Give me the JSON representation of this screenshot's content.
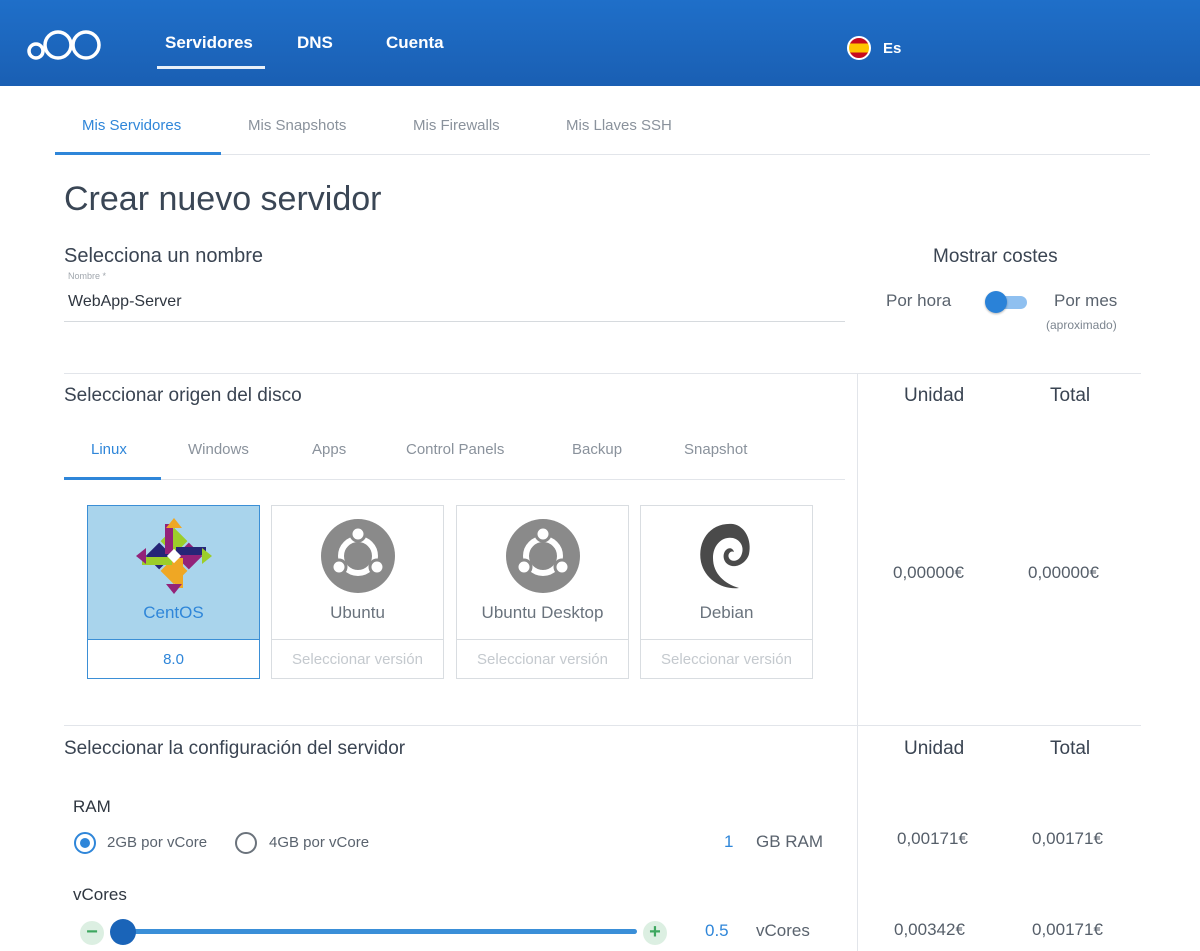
{
  "header": {
    "nav": [
      "Servidores",
      "DNS",
      "Cuenta"
    ],
    "language": "Es"
  },
  "subtabs": [
    "Mis Servidores",
    "Mis Snapshots",
    "Mis Firewalls",
    "Mis Llaves SSH"
  ],
  "page_title": "Crear nuevo servidor",
  "name_section": {
    "title": "Selecciona un nombre",
    "field_label": "Nombre *",
    "field_value": "WebApp-Server"
  },
  "costs": {
    "title": "Mostrar costes",
    "left_label": "Por hora",
    "right_label": "Por mes",
    "right_note": "(aproximado)",
    "toggle_state": "Por hora"
  },
  "disk_section": {
    "title": "Seleccionar origen del disco",
    "tabs": [
      "Linux",
      "Windows",
      "Apps",
      "Control Panels",
      "Backup",
      "Snapshot"
    ],
    "cards": [
      {
        "name": "CentOS",
        "version": "8.0",
        "icon": "centos-icon",
        "selected": true
      },
      {
        "name": "Ubuntu",
        "version": "Seleccionar versión",
        "icon": "ubuntu-icon",
        "selected": false
      },
      {
        "name": "Ubuntu Desktop",
        "version": "Seleccionar versión",
        "icon": "ubuntu-icon",
        "selected": false
      },
      {
        "name": "Debian",
        "version": "Seleccionar versión",
        "icon": "debian-icon",
        "selected": false
      }
    ],
    "col_unit": "Unidad",
    "col_total": "Total",
    "unit_price": "0,00000€",
    "total_price": "0,00000€"
  },
  "config_section": {
    "title": "Seleccionar la configuración del servidor",
    "col_unit": "Unidad",
    "col_total": "Total",
    "ram": {
      "label": "RAM",
      "options": [
        "2GB por vCore",
        "4GB por vCore"
      ],
      "selected": "2GB por vCore",
      "value": "1",
      "unit": "GB RAM",
      "unit_price": "0,00171€",
      "total_price": "0,00171€"
    },
    "vcores": {
      "label": "vCores",
      "value": "0.5",
      "unit": "vCores",
      "unit_price": "0,00342€",
      "total_price": "0,00171€",
      "minus": "−",
      "plus": "+"
    }
  },
  "colors": {
    "header_blue": "#1f6fc9",
    "accent": "#2f86d9",
    "selected_card": "#a9d4ec"
  }
}
